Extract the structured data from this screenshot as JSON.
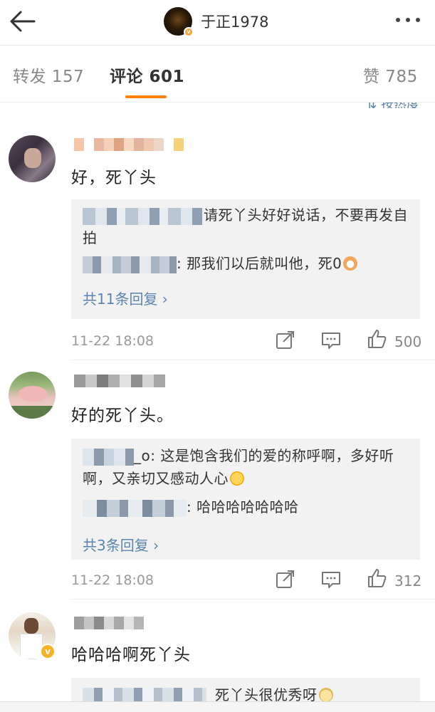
{
  "header": {
    "title": "于正1978",
    "back_icon": "back-arrow-icon",
    "more_icon": "more-dots-icon"
  },
  "tabs": [
    {
      "label": "转发 157"
    },
    {
      "label": "评论 601"
    },
    {
      "label": "赞 785"
    }
  ],
  "sort_label": "按热度",
  "comments": [
    {
      "text": "好，死丫头",
      "replies": [
        {
          "text": "请死丫头好好说话，不要再发自拍"
        },
        {
          "text": ": 那我们以后就叫他，死0"
        }
      ],
      "more_replies": "共11条回复 ›",
      "time": "11-22 18:08",
      "likes": "500"
    },
    {
      "text": "好的死丫头。",
      "replies": [
        {
          "text": "_o: 这是饱含我们的爱的称呼啊，多好听啊，又亲切又感动人心"
        },
        {
          "text": ": 哈哈哈哈哈哈哈"
        }
      ],
      "more_replies": "共3条回复 ›",
      "time": "11-22 18:08",
      "likes": "312"
    },
    {
      "text": "哈哈哈啊死丫头",
      "replies": [
        {
          "text": "死丫头很优秀呀"
        }
      ]
    }
  ],
  "colors": {
    "accent": "#ff8200",
    "link": "#5b84b1",
    "verified": "#f5b323"
  }
}
